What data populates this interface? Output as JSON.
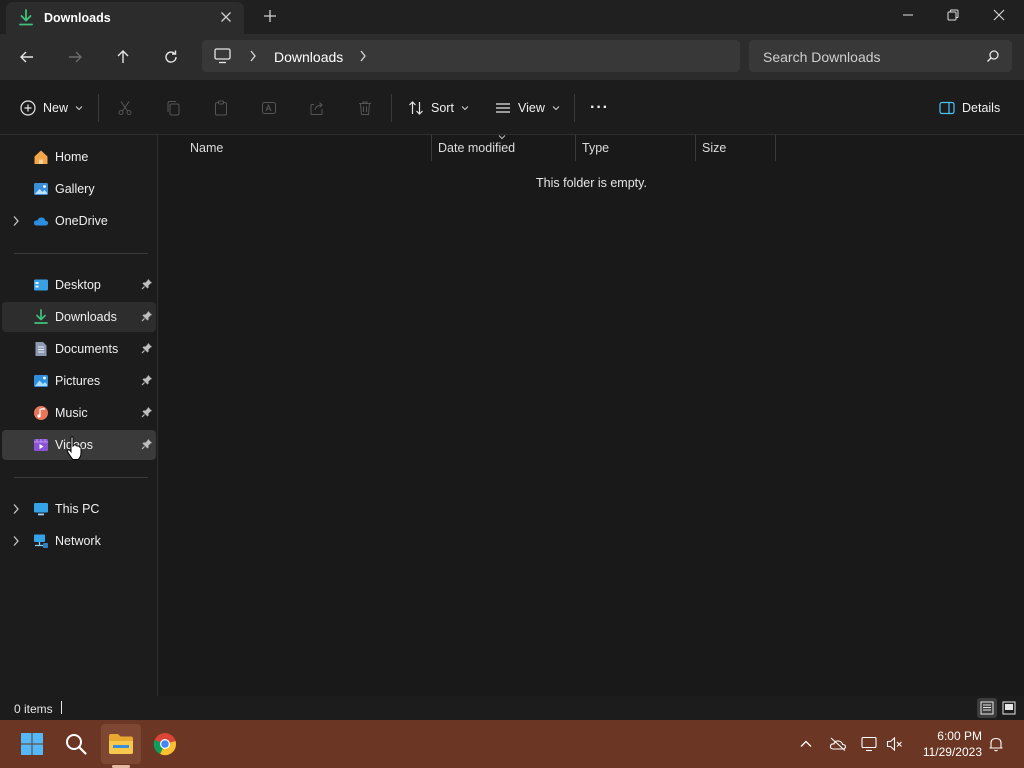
{
  "window": {
    "tab_title": "Downloads",
    "minimize": "—",
    "maximize": "□",
    "close": "✕"
  },
  "address": {
    "location": "Downloads"
  },
  "search": {
    "placeholder": "Search Downloads"
  },
  "commands": {
    "new_label": "New",
    "sort_label": "Sort",
    "view_label": "View",
    "more_label": "···",
    "details_label": "Details"
  },
  "sidebar": {
    "items": [
      {
        "label": "Home",
        "icon": "home-icon"
      },
      {
        "label": "Gallery",
        "icon": "gallery-icon"
      },
      {
        "label": "OneDrive",
        "icon": "onedrive-icon"
      },
      {
        "label": "Desktop",
        "icon": "desktop-icon"
      },
      {
        "label": "Downloads",
        "icon": "download-icon"
      },
      {
        "label": "Documents",
        "icon": "documents-icon"
      },
      {
        "label": "Pictures",
        "icon": "pictures-icon"
      },
      {
        "label": "Music",
        "icon": "music-icon"
      },
      {
        "label": "Videos",
        "icon": "videos-icon"
      },
      {
        "label": "This PC",
        "icon": "pc-icon"
      },
      {
        "label": "Network",
        "icon": "network-icon"
      }
    ]
  },
  "columns": {
    "name": "Name",
    "date_modified": "Date modified",
    "type": "Type",
    "size": "Size"
  },
  "content": {
    "empty_message": "This folder is empty."
  },
  "status": {
    "item_count": "0 items"
  },
  "taskbar": {
    "time": "6:00 PM",
    "date": "11/29/2023"
  },
  "colors": {
    "accent": "#4cc2ff",
    "taskbar": "#6b3623",
    "folder": "#f2c14e"
  }
}
